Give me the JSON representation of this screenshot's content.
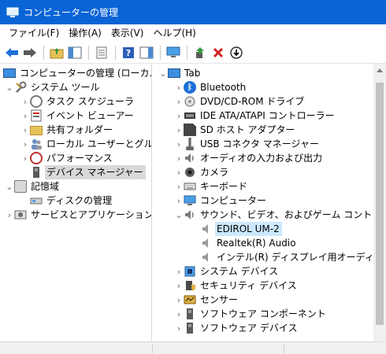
{
  "window": {
    "title": "コンピューターの管理"
  },
  "menu": [
    "ファイル(F)",
    "操作(A)",
    "表示(V)",
    "ヘルプ(H)"
  ],
  "toolbar": {
    "buttons": [
      "back-arrow-icon",
      "forward-arrow-icon",
      "up-folder-icon",
      "show-hide-tree-icon",
      "properties-icon",
      "help-icon",
      "action-pane-icon",
      "monitor-icon",
      "update-driver-icon",
      "uninstall-icon",
      "disable-device-icon"
    ]
  },
  "left_tree": {
    "root": "コンピューターの管理 (ローカル)",
    "system_tools": "システム ツール",
    "task_scheduler": "タスク スケジューラ",
    "event_viewer": "イベント ビューアー",
    "shared_folders": "共有フォルダー",
    "local_users": "ローカル ユーザーとグループ",
    "performance": "パフォーマンス",
    "device_manager": "デバイス マネージャー",
    "storage": "記憶域",
    "disk_management": "ディスクの管理",
    "services": "サービスとアプリケーション"
  },
  "right_tree": {
    "root": "Tab",
    "items": [
      "Bluetooth",
      "DVD/CD-ROM ドライブ",
      "IDE ATA/ATAPI コントローラー",
      "SD ホスト アダプター",
      "USB コネクタ マネージャー",
      "オーディオの入力および出力",
      "カメラ",
      "キーボード",
      "コンピューター",
      "サウンド、ビデオ、およびゲーム コントローラー",
      "EDIROL UM-2",
      "Realtek(R) Audio",
      "インテル(R) ディスプレイ用オーディオ",
      "システム デバイス",
      "セキュリティ デバイス",
      "センサー",
      "ソフトウェア コンポーネント",
      "ソフトウェア デバイス"
    ]
  },
  "colors": {
    "title_bar": "#0a64d6",
    "selection_gray": "#d9d9d9",
    "selection_blue": "#cce8ff"
  }
}
